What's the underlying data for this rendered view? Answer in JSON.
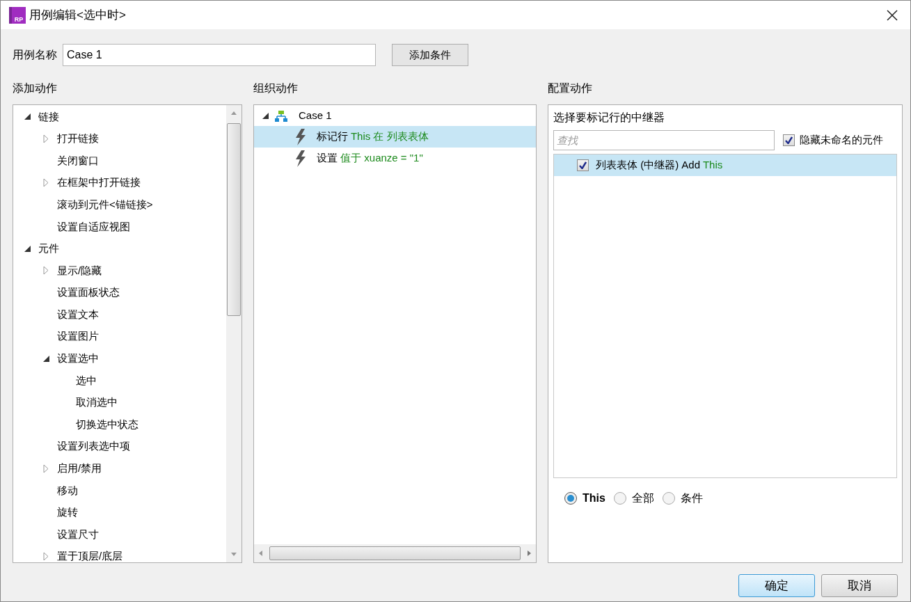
{
  "window": {
    "logo": "RP",
    "title": "用例编辑<选中时>"
  },
  "case_name": {
    "label": "用例名称",
    "value": "Case 1",
    "add_condition_button": "添加条件"
  },
  "add_actions": {
    "heading": "添加动作",
    "tree": [
      {
        "label": "链接",
        "expanded": true,
        "children": [
          {
            "label": "打开链接",
            "expanded": false
          },
          {
            "label": "关闭窗口"
          },
          {
            "label": "在框架中打开链接",
            "expanded": false
          },
          {
            "label": "滚动到元件<锚链接>"
          },
          {
            "label": "设置自适应视图"
          }
        ]
      },
      {
        "label": "元件",
        "expanded": true,
        "children": [
          {
            "label": "显示/隐藏",
            "expanded": false
          },
          {
            "label": "设置面板状态"
          },
          {
            "label": "设置文本"
          },
          {
            "label": "设置图片"
          },
          {
            "label": "设置选中",
            "expanded": true,
            "children": [
              {
                "label": "选中"
              },
              {
                "label": "取消选中"
              },
              {
                "label": "切换选中状态"
              }
            ]
          },
          {
            "label": "设置列表选中项"
          },
          {
            "label": "启用/禁用",
            "expanded": false
          },
          {
            "label": "移动"
          },
          {
            "label": "旋转"
          },
          {
            "label": "设置尺寸"
          },
          {
            "label": "置于顶层/底层",
            "expanded": false
          }
        ]
      }
    ]
  },
  "organize_actions": {
    "heading": "组织动作",
    "case": {
      "label": "Case 1",
      "expanded": true
    },
    "actions": [
      {
        "selected": true,
        "parts": [
          {
            "text": "标记行",
            "highlighted": false
          },
          {
            "text": " This 在 列表表体",
            "highlighted": true
          }
        ]
      },
      {
        "selected": false,
        "parts": [
          {
            "text": "设置",
            "highlighted": false
          },
          {
            "text": " 值于 xuanze = \"1\"",
            "highlighted": true
          }
        ]
      }
    ]
  },
  "configure_action": {
    "heading": "配置动作",
    "prompt": "选择要标记行的中继器",
    "search": {
      "placeholder": "查找"
    },
    "hide_unnamed": {
      "label": "隐藏未命名的元件",
      "checked": true
    },
    "repeaters": [
      {
        "checked": true,
        "selected": true,
        "parts": [
          {
            "text": "列表表体 (中继器) Add",
            "highlighted": false
          },
          {
            "text": " This",
            "highlighted": true
          }
        ]
      }
    ],
    "options": [
      {
        "label": "This",
        "selected": true
      },
      {
        "label": "全部",
        "selected": false
      },
      {
        "label": "条件",
        "selected": false
      }
    ]
  },
  "buttons": [
    {
      "label": "确定",
      "kind": "primary"
    },
    {
      "label": "取消",
      "kind": "secondary"
    }
  ]
}
